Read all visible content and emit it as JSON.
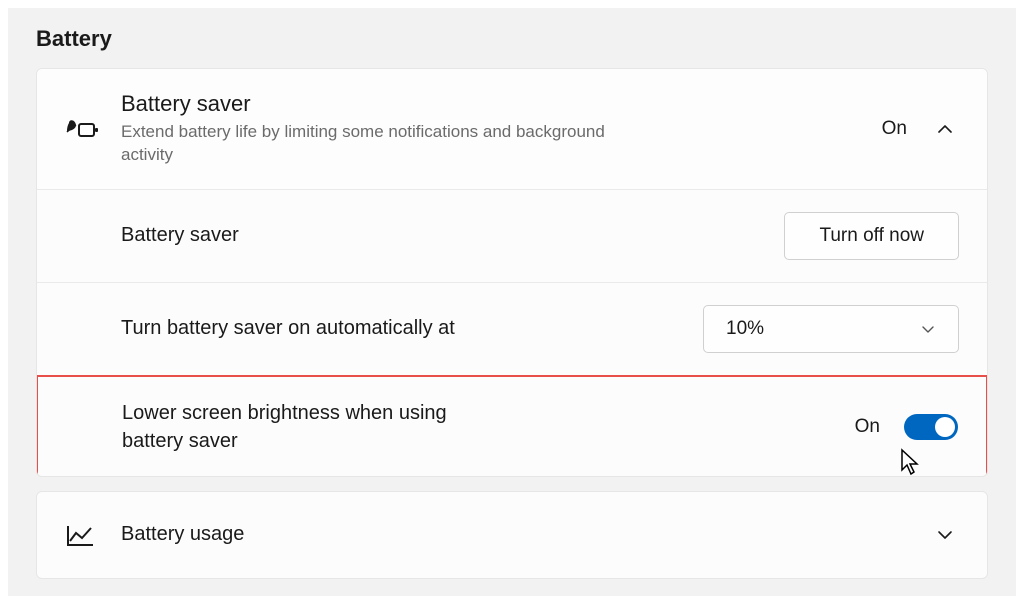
{
  "section": {
    "title": "Battery"
  },
  "battery_saver": {
    "header_title": "Battery saver",
    "header_subtitle": "Extend battery life by limiting some notifications and background activity",
    "header_status": "On",
    "row1_label": "Battery saver",
    "row1_button": "Turn off now",
    "row2_label": "Turn battery saver on automatically at",
    "row2_value": "10%",
    "row3_label": "Lower screen brightness when using battery saver",
    "row3_status": "On"
  },
  "battery_usage": {
    "label": "Battery usage"
  }
}
